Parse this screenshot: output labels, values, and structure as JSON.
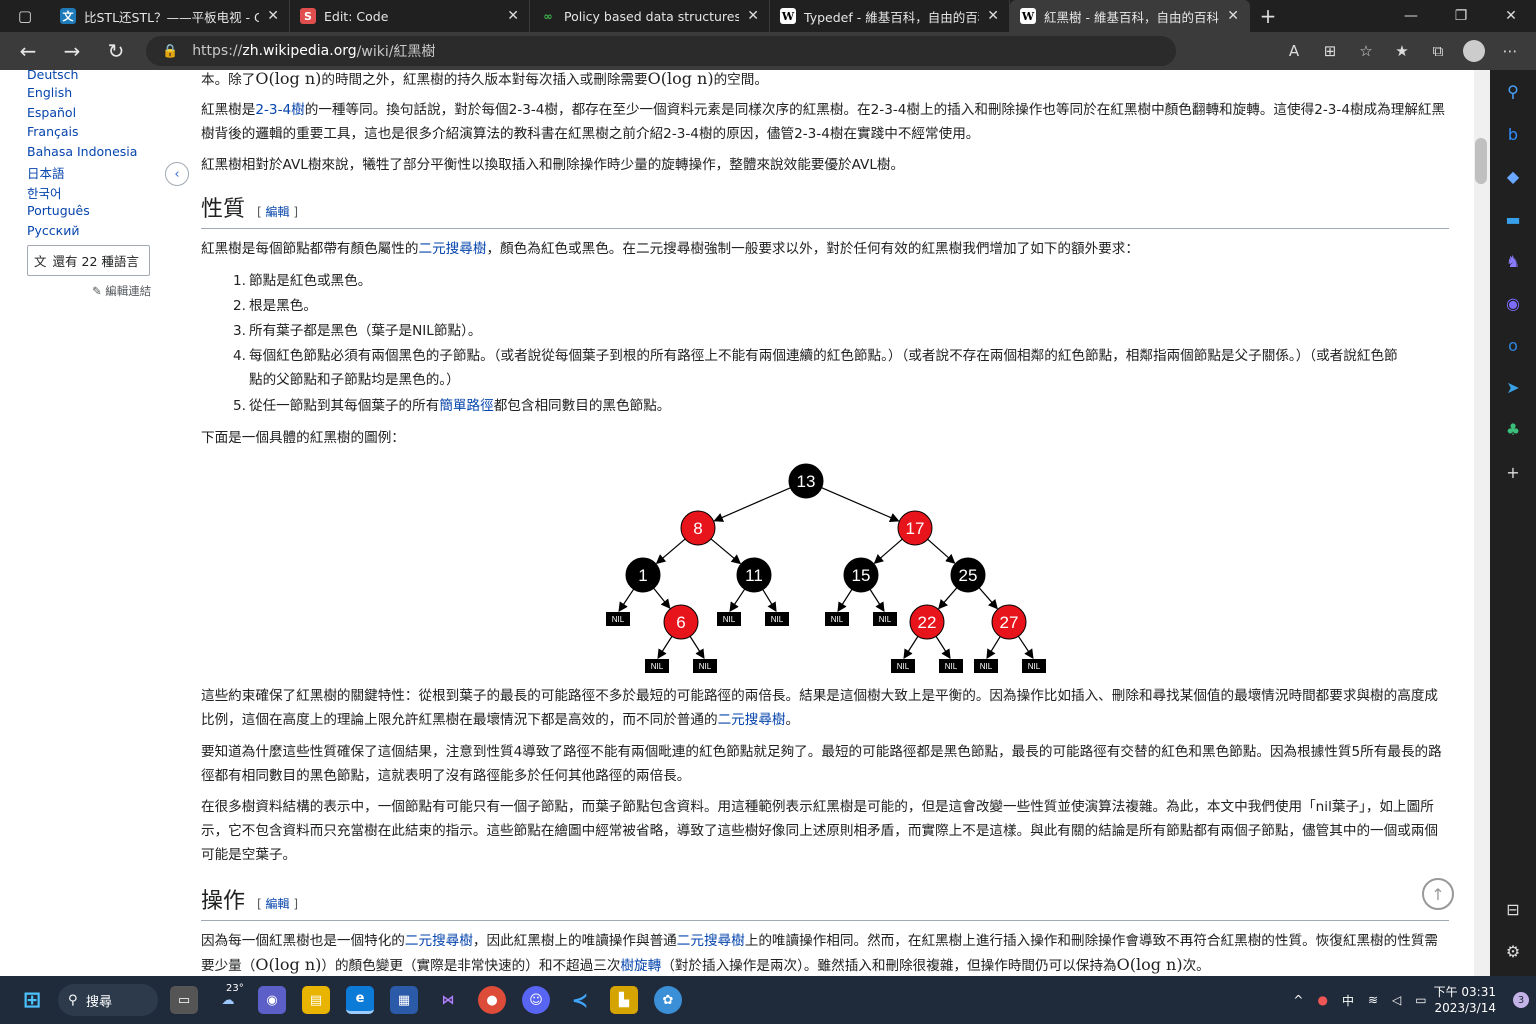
{
  "browser": {
    "tabs": [
      {
        "title": "比STL还STL？——平板电视 - Cha",
        "fav": "文",
        "favbg": "#1e7ab8"
      },
      {
        "title": "Edit: Code",
        "fav": "S",
        "favbg": "#e04e4e"
      },
      {
        "title": "Policy based data structures in g",
        "fav": "∞",
        "favbg": "#2e2e2e"
      },
      {
        "title": "Typedef - 維基百科，自由的百科",
        "fav": "W",
        "favbg": "#ffffff"
      },
      {
        "title": "紅黑樹 - 維基百科，自由的百科全",
        "fav": "W",
        "favbg": "#ffffff"
      }
    ],
    "url_prefix": "https://",
    "url_host": "zh.wikipedia.org",
    "url_path": "/wiki/紅黑樹"
  },
  "sidebar_langs": [
    "Deutsch",
    "English",
    "Español",
    "Français",
    "Bahasa Indonesia",
    "日本語",
    "한국어",
    "Português",
    "Русский"
  ],
  "lang_button": "還有 22 種語言",
  "edit_links": "編輯連結",
  "article": {
    "p0a": "本。除了",
    "p0m": "O(log n)",
    "p0b": "的時間之外，紅黑樹的持久版本對每次插入或刪除需要",
    "p0m2": "O(log n)",
    "p0c": "的空間。",
    "p1a": "紅黑樹是",
    "p1link": "2-3-4樹",
    "p1b": "的一種等同。換句話說，對於每個2-3-4樹，都存在至少一個資料元素是同樣次序的紅黑樹。在2-3-4樹上的插入和刪除操作也等同於在紅黑樹中顏色翻轉和旋轉。這使得2-3-4樹成為理解紅黑樹背後的邏輯的重要工具，這也是很多介紹演算法的教科書在紅黑樹之前介紹2-3-4樹的原因，儘管2-3-4樹在實踐中不經常使用。",
    "p2": "紅黑樹相對於AVL樹來說，犧牲了部分平衡性以換取插入和刪除操作時少量的旋轉操作，整體來說效能要優於AVL樹。",
    "h_prop": "性質",
    "edit": "編輯",
    "p3a": "紅黑樹是每個節點都帶有顏色屬性的",
    "p3link": "二元搜尋樹",
    "p3b": "，顏色為紅色或黑色。在二元搜尋樹強制一般要求以外，對於任何有效的紅黑樹我們增加了如下的額外要求：",
    "li1": "節點是紅色或黑色。",
    "li2": "根是黑色。",
    "li3": "所有葉子都是黑色（葉子是NIL節點）。",
    "li4": "每個紅色節點必須有兩個黑色的子節點。（或者說從每個葉子到根的所有路徑上不能有兩個連續的紅色節點。）（或者說不存在兩個相鄰的紅色節點，相鄰指兩個節點是父子關係。）（或者說紅色節點的父節點和子節點均是黑色的。）",
    "li5a": "從任一節點到其每個葉子的所有",
    "li5link": "簡單路徑",
    "li5b": "都包含相同數目的黑色節點。",
    "p4": "下面是一個具體的紅黑樹的圖例：",
    "p5a": "這些約束確保了紅黑樹的關鍵特性：從根到葉子的最長的可能路徑不多於最短的可能路徑的兩倍長。結果是這個樹大致上是平衡的。因為操作比如插入、刪除和尋找某個值的最壞情況時間都要求與樹的高度成比例，這個在高度上的理論上限允許紅黑樹在最壞情況下都是高效的，而不同於普通的",
    "p5link": "二元搜尋樹",
    "p5b": "。",
    "p6": "要知道為什麼這些性質確保了這個結果，注意到性質4導致了路徑不能有兩個毗連的紅色節點就足夠了。最短的可能路徑都是黑色節點，最長的可能路徑有交替的紅色和黑色節點。因為根據性質5所有最長的路徑都有相同數目的黑色節點，這就表明了沒有路徑能多於任何其他路徑的兩倍長。",
    "p7": "在很多樹資料結構的表示中，一個節點有可能只有一個子節點，而葉子節點包含資料。用這種範例表示紅黑樹是可能的，但是這會改變一些性質並使演算法複雜。為此，本文中我們使用「nil葉子」，如上圖所示，它不包含資料而只充當樹在此結束的指示。這些節點在繪圖中經常被省略，導致了這些樹好像同上述原則相矛盾，而實際上不是這樣。與此有關的結論是所有節點都有兩個子節點，儘管其中的一個或兩個可能是空葉子。",
    "h_ops": "操作",
    "p8a": "因為每一個紅黑樹也是一個特化的",
    "p8l1": "二元搜尋樹",
    "p8b": "，因此紅黑樹上的唯讀操作與普通",
    "p8l2": "二元搜尋樹",
    "p8c": "上的唯讀操作相同。然而，在紅黑樹上進行插入操作和刪除操作會導致不再符合紅黑樹的性質。恢復紅黑樹的性質需要少量（",
    "p8m": "O(log n)",
    "p8d": "）的顏色變更（實際是非常快速的）和不超過三次",
    "p8l3": "樹旋轉",
    "p8e": "（對於插入操作是兩次）。雖然插入和刪除很複雜，但操作時間仍可以保持為",
    "p8m2": "O(log n)",
    "p8f": "次。"
  },
  "tree": {
    "nodes": [
      {
        "label": "13",
        "color": "black"
      },
      {
        "label": "8",
        "color": "red"
      },
      {
        "label": "17",
        "color": "red"
      },
      {
        "label": "1",
        "color": "black"
      },
      {
        "label": "11",
        "color": "black"
      },
      {
        "label": "15",
        "color": "black"
      },
      {
        "label": "25",
        "color": "black"
      },
      {
        "label": "6",
        "color": "red"
      },
      {
        "label": "22",
        "color": "red"
      },
      {
        "label": "27",
        "color": "red"
      }
    ],
    "nil": "NIL"
  },
  "taskbar": {
    "search": "搜尋",
    "weather": "23°",
    "ime": "中",
    "time": "下午 03:31",
    "date": "2023/3/14",
    "badge": "3"
  },
  "colors": {
    "red": "#e8141b",
    "black": "#000000",
    "link": "#0645ad"
  }
}
